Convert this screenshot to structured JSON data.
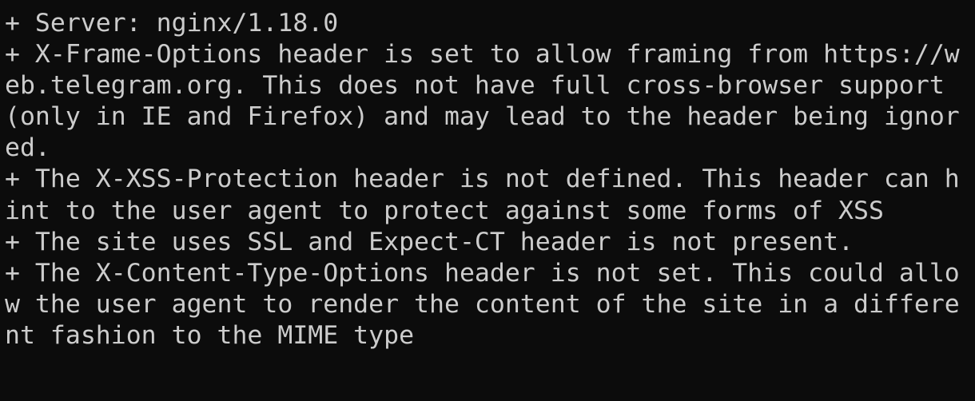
{
  "terminal": {
    "lines": [
      "+ Server: nginx/1.18.0",
      "+ X-Frame-Options header is set to allow framing from https://w",
      "eb.telegram.org. This does not have full cross-browser support",
      "(only in IE and Firefox) and may lead to the header being ignor",
      "ed.",
      "+ The X-XSS-Protection header is not defined. This header can h",
      "int to the user agent to protect against some forms of XSS",
      "+ The site uses SSL and Expect-CT header is not present.",
      "+ The X-Content-Type-Options header is not set. This could allo",
      "w the user agent to render the content of the site in a differe",
      "nt fashion to the MIME type"
    ]
  },
  "colors": {
    "background": "#0c0c0c",
    "foreground": "#cccccc"
  }
}
